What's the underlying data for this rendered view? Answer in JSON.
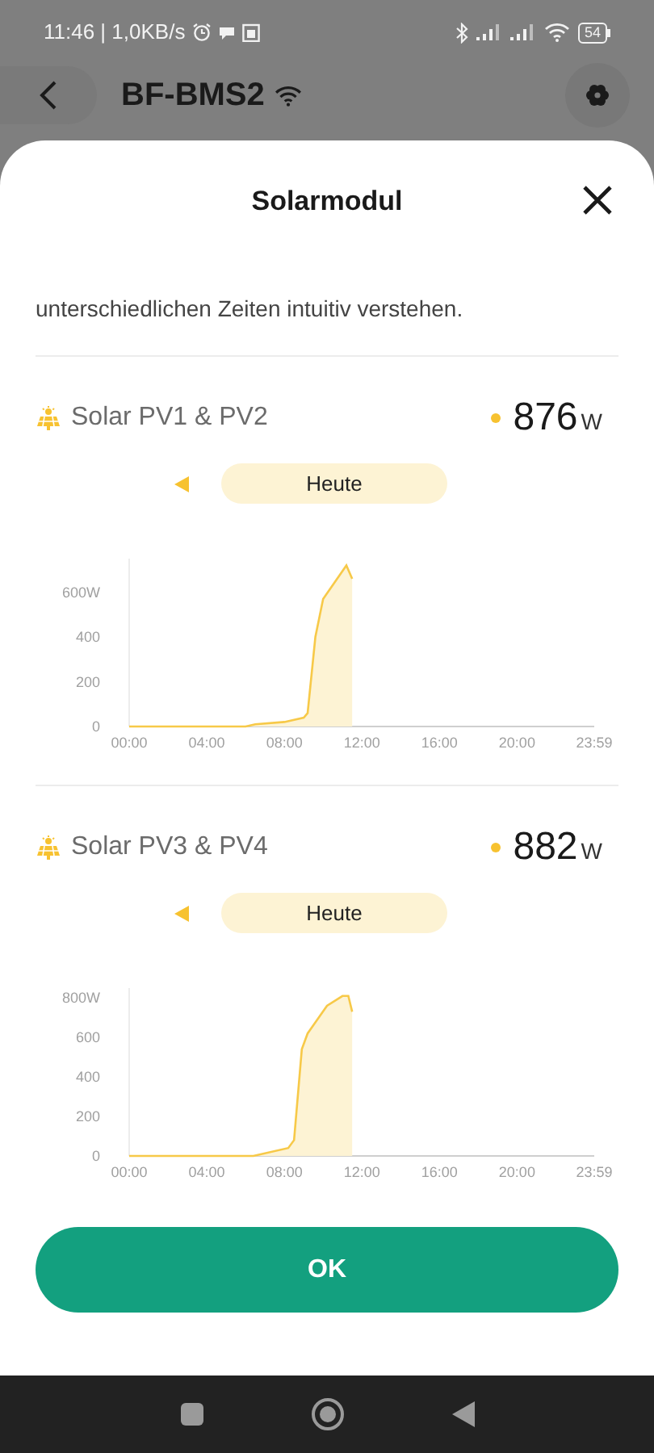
{
  "status_bar": {
    "time": "11:46 | 1,0KB/s",
    "battery": "54"
  },
  "header": {
    "title": "BF-BMS2"
  },
  "sheet": {
    "title": "Solarmodul",
    "intro": "unterschiedlichen Zeiten intuitiv verstehen.",
    "panels": [
      {
        "title": "Solar PV1 & PV2",
        "power": "876",
        "unit": "W",
        "period": "Heute",
        "chart_data": {
          "type": "area",
          "x": [
            0,
            6,
            6.5,
            8,
            9,
            9.2,
            9.6,
            10,
            11.2,
            11.5
          ],
          "series": [
            {
              "color": "#f7c948",
              "values": [
                0,
                0,
                10,
                20,
                40,
                60,
                400,
                570,
                720,
                660
              ]
            }
          ],
          "xlim": [
            0,
            23.98
          ],
          "ylim": [
            0,
            750
          ],
          "xticks": [
            {
              "value": 0,
              "label": "00:00"
            },
            {
              "value": 4,
              "label": "04:00"
            },
            {
              "value": 8,
              "label": "08:00"
            },
            {
              "value": 12,
              "label": "12:00"
            },
            {
              "value": 16,
              "label": "16:00"
            },
            {
              "value": 20,
              "label": "20:00"
            },
            {
              "value": 23.98,
              "label": "23:59"
            }
          ],
          "yticks": [
            0,
            200,
            400,
            {
              "value": 600,
              "label": "600W"
            }
          ]
        }
      },
      {
        "title": "Solar PV3 & PV4",
        "power": "882",
        "unit": "W",
        "period": "Heute",
        "chart_data": {
          "type": "area",
          "x": [
            0,
            6.4,
            8.2,
            8.5,
            8.9,
            9.2,
            10.2,
            11,
            11.3,
            11.5
          ],
          "series": [
            {
              "color": "#f7c948",
              "values": [
                0,
                0,
                40,
                80,
                540,
                620,
                760,
                810,
                810,
                730
              ]
            }
          ],
          "xlim": [
            0,
            23.98
          ],
          "ylim": [
            0,
            850
          ],
          "xticks": [
            {
              "value": 0,
              "label": "00:00"
            },
            {
              "value": 4,
              "label": "04:00"
            },
            {
              "value": 8,
              "label": "08:00"
            },
            {
              "value": 12,
              "label": "12:00"
            },
            {
              "value": 16,
              "label": "16:00"
            },
            {
              "value": 20,
              "label": "20:00"
            },
            {
              "value": 23.98,
              "label": "23:59"
            }
          ],
          "yticks": [
            0,
            200,
            400,
            600,
            {
              "value": 800,
              "label": "800W"
            }
          ]
        }
      }
    ],
    "ok_button": "OK"
  }
}
